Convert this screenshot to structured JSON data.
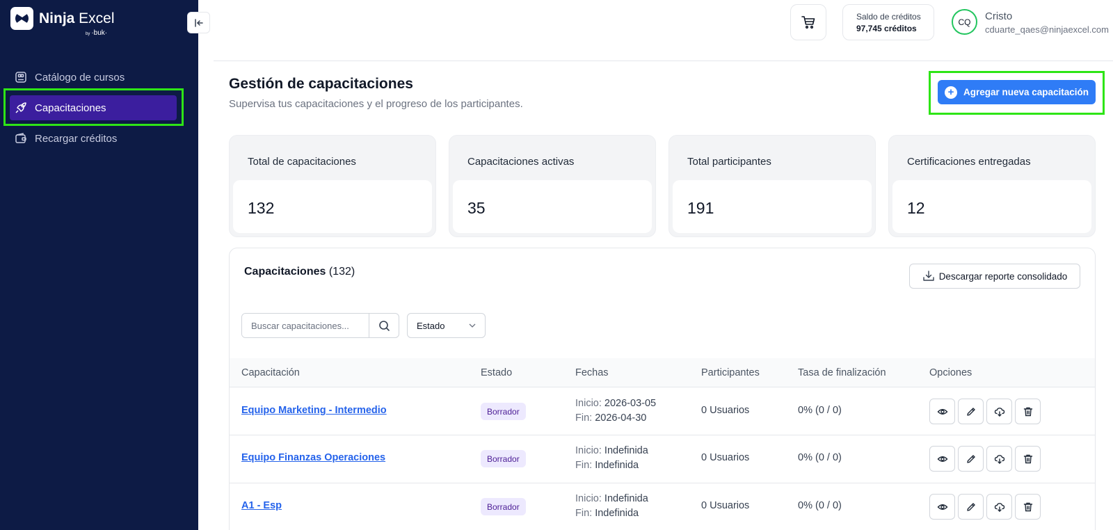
{
  "brand": {
    "name_bold": "Ninja",
    "name_regular": " Excel",
    "by": "by",
    "sub": "·buk·"
  },
  "sidebar": {
    "items": [
      {
        "label": "Catálogo de cursos",
        "icon": "catalog-icon"
      },
      {
        "label": "Capacitaciones",
        "icon": "rocket-icon",
        "active": true
      },
      {
        "label": "Recargar créditos",
        "icon": "wallet-icon"
      }
    ]
  },
  "header": {
    "credits_label": "Saldo de créditos",
    "credits_value": "97,745 créditos",
    "user_initials": "CQ",
    "user_name": "Cristo",
    "user_email": "cduarte_qaes@ninjaexcel.com"
  },
  "page": {
    "title": "Gestión de capacitaciones",
    "subtitle": "Supervisa tus capacitaciones y el progreso de los participantes.",
    "add_button": "Agregar nueva capacitación"
  },
  "stats": [
    {
      "label": "Total de capacitaciones",
      "value": "132"
    },
    {
      "label": "Capacitaciones activas",
      "value": "35"
    },
    {
      "label": "Total participantes",
      "value": "191"
    },
    {
      "label": "Certificaciones entregadas",
      "value": "12"
    }
  ],
  "table": {
    "title": "Capacitaciones",
    "count": "(132)",
    "download_button": "Descargar reporte consolidado",
    "search_placeholder": "Buscar capacitaciones...",
    "status_filter": "Estado",
    "columns": [
      "Capacitación",
      "Estado",
      "Fechas",
      "Participantes",
      "Tasa de finalización",
      "Opciones"
    ],
    "rows": [
      {
        "name": "Equipo Marketing - Intermedio",
        "status": "Borrador",
        "start_label": "Inicio:",
        "start": "2026-03-05",
        "end_label": "Fin:",
        "end": "2026-04-30",
        "participants": "0 Usuarios",
        "rate": "0% (0 / 0)"
      },
      {
        "name": "Equipo Finanzas Operaciones",
        "status": "Borrador",
        "start_label": "Inicio:",
        "start": "Indefinida",
        "end_label": "Fin:",
        "end": "Indefinida",
        "participants": "0 Usuarios",
        "rate": "0% (0 / 0)"
      },
      {
        "name": "A1 - Esp",
        "status": "Borrador",
        "start_label": "Inicio:",
        "start": "Indefinida",
        "end_label": "Fin:",
        "end": "Indefinida",
        "participants": "0 Usuarios",
        "rate": "0% (0 / 0)"
      }
    ]
  },
  "colors": {
    "sidebar": "#0d1b45",
    "active_nav": "#3b1e9e",
    "primary": "#2f7cf6",
    "highlight": "#2ee516",
    "badge_bg": "#ede9fe"
  }
}
